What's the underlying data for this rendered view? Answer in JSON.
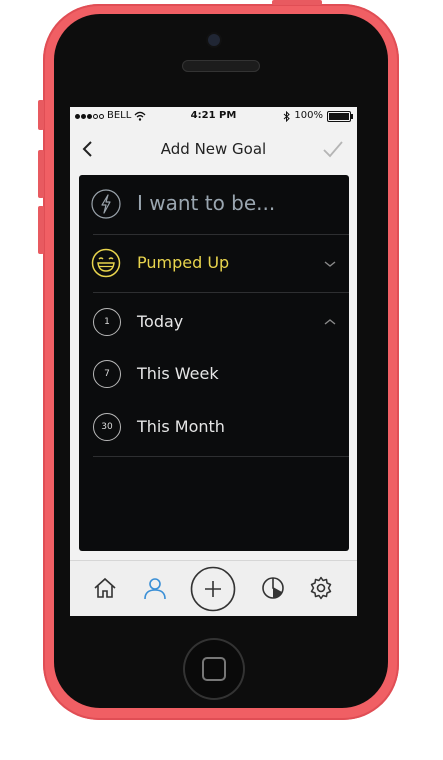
{
  "status_bar": {
    "carrier": "BELL",
    "time": "4:21 PM",
    "battery": "100%",
    "signal_dots_filled": 3,
    "signal_dots_total": 5
  },
  "nav": {
    "title": "Add New Goal",
    "back_icon": "chevron-left-icon",
    "confirm_icon": "checkmark-icon"
  },
  "goal": {
    "prompt": "I want to be...",
    "prompt_icon": "lightning-icon",
    "feeling": "Pumped Up",
    "feeling_icon": "grinning-face-icon",
    "feeling_color": "#e8d44d"
  },
  "timeframes": [
    {
      "number": "1",
      "label": "Today"
    },
    {
      "number": "7",
      "label": "This Week"
    },
    {
      "number": "30",
      "label": "This Month"
    }
  ],
  "tabs": [
    {
      "icon": "home-icon",
      "active": false
    },
    {
      "icon": "profile-icon",
      "active": true
    },
    {
      "icon": "add-icon",
      "active": false
    },
    {
      "icon": "pie-chart-icon",
      "active": false
    },
    {
      "icon": "gear-icon",
      "active": false
    }
  ],
  "colors": {
    "phone_body": "#f05f64",
    "panel": "#0b0c0d",
    "accent_yellow": "#e8d44d",
    "active_tab": "#3a8fd6"
  }
}
